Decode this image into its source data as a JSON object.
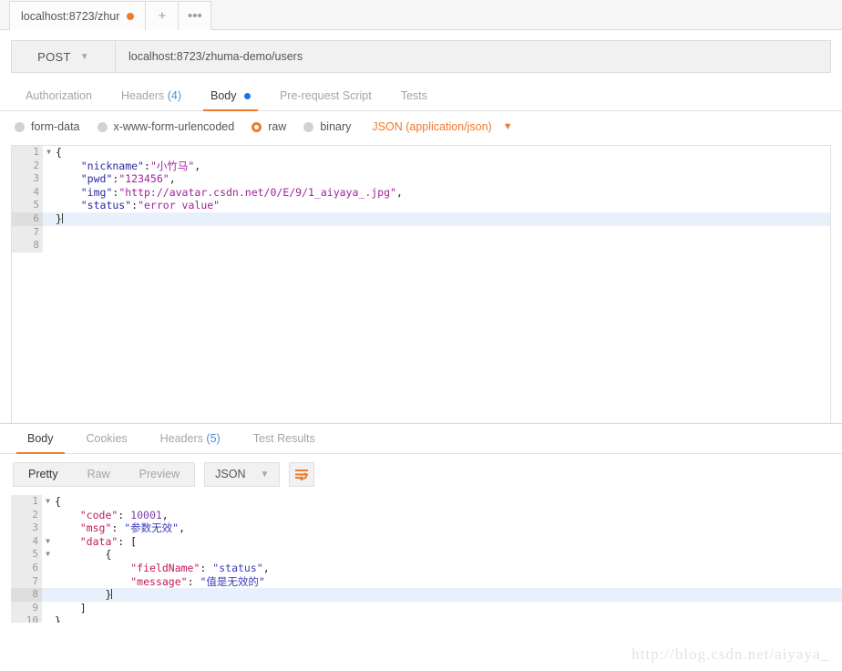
{
  "tabstrip": {
    "request_tab_label": "localhost:8723/zhur",
    "new_tab_label": "+",
    "more_label": "•••"
  },
  "request": {
    "method": "POST",
    "url": "localhost:8723/zhuma-demo/users",
    "tabs": [
      {
        "label": "Authorization",
        "count": "",
        "active": false
      },
      {
        "label": "Headers",
        "count": "(4)",
        "active": false
      },
      {
        "label": "Body",
        "count": "",
        "active": true
      },
      {
        "label": "Pre-request Script",
        "count": "",
        "active": false
      },
      {
        "label": "Tests",
        "count": "",
        "active": false
      }
    ],
    "body_types": [
      {
        "label": "form-data",
        "selected": false
      },
      {
        "label": "x-www-form-urlencoded",
        "selected": false
      },
      {
        "label": "raw",
        "selected": true
      },
      {
        "label": "binary",
        "selected": false
      }
    ],
    "content_type": "JSON (application/json)",
    "editor": {
      "lines": [
        {
          "num": "1",
          "fold": true,
          "text": "{",
          "highlight": false
        },
        {
          "num": "2",
          "fold": false,
          "text": "    \"nickname\":\"小竹马\",",
          "highlight": false
        },
        {
          "num": "3",
          "fold": false,
          "text": "    \"pwd\":\"123456\",",
          "highlight": false
        },
        {
          "num": "4",
          "fold": false,
          "text": "    \"img\":\"http://avatar.csdn.net/0/E/9/1_aiyaya_.jpg\",",
          "highlight": false
        },
        {
          "num": "5",
          "fold": false,
          "text": "    \"status\":\"error value\"",
          "highlight": false
        },
        {
          "num": "6",
          "fold": false,
          "text": "}",
          "highlight": true
        },
        {
          "num": "7",
          "fold": false,
          "text": "",
          "highlight": false
        },
        {
          "num": "8",
          "fold": false,
          "text": "",
          "highlight": false
        }
      ]
    }
  },
  "response": {
    "tabs": [
      {
        "label": "Body",
        "count": "",
        "active": true
      },
      {
        "label": "Cookies",
        "count": "",
        "active": false
      },
      {
        "label": "Headers",
        "count": "(5)",
        "active": false
      },
      {
        "label": "Test Results",
        "count": "",
        "active": false
      }
    ],
    "view_modes": [
      {
        "label": "Pretty",
        "active": true
      },
      {
        "label": "Raw",
        "active": false
      },
      {
        "label": "Preview",
        "active": false
      }
    ],
    "format": "JSON",
    "wrap_icon": "word-wrap-icon",
    "editor": {
      "lines": [
        {
          "num": "1",
          "fold": true,
          "text": "{",
          "highlight": false
        },
        {
          "num": "2",
          "fold": false,
          "text": "    \"code\": 10001,",
          "highlight": false
        },
        {
          "num": "3",
          "fold": false,
          "text": "    \"msg\": \"参数无效\",",
          "highlight": false
        },
        {
          "num": "4",
          "fold": true,
          "text": "    \"data\": [",
          "highlight": false
        },
        {
          "num": "5",
          "fold": true,
          "text": "        {",
          "highlight": false
        },
        {
          "num": "6",
          "fold": false,
          "text": "            \"fieldName\": \"status\",",
          "highlight": false
        },
        {
          "num": "7",
          "fold": false,
          "text": "            \"message\": \"值是无效的\"",
          "highlight": false
        },
        {
          "num": "8",
          "fold": false,
          "text": "        }",
          "highlight": true
        },
        {
          "num": "9",
          "fold": false,
          "text": "    ]",
          "highlight": false
        },
        {
          "num": "10",
          "fold": false,
          "text": "}",
          "highlight": false
        }
      ]
    }
  },
  "watermark": "http://blog.csdn.net/aiyaya_",
  "colors": {
    "accent": "#f0792b",
    "link": "#4a90d9",
    "active_line": "#e8f0fb",
    "gutter": "#ebebeb"
  }
}
